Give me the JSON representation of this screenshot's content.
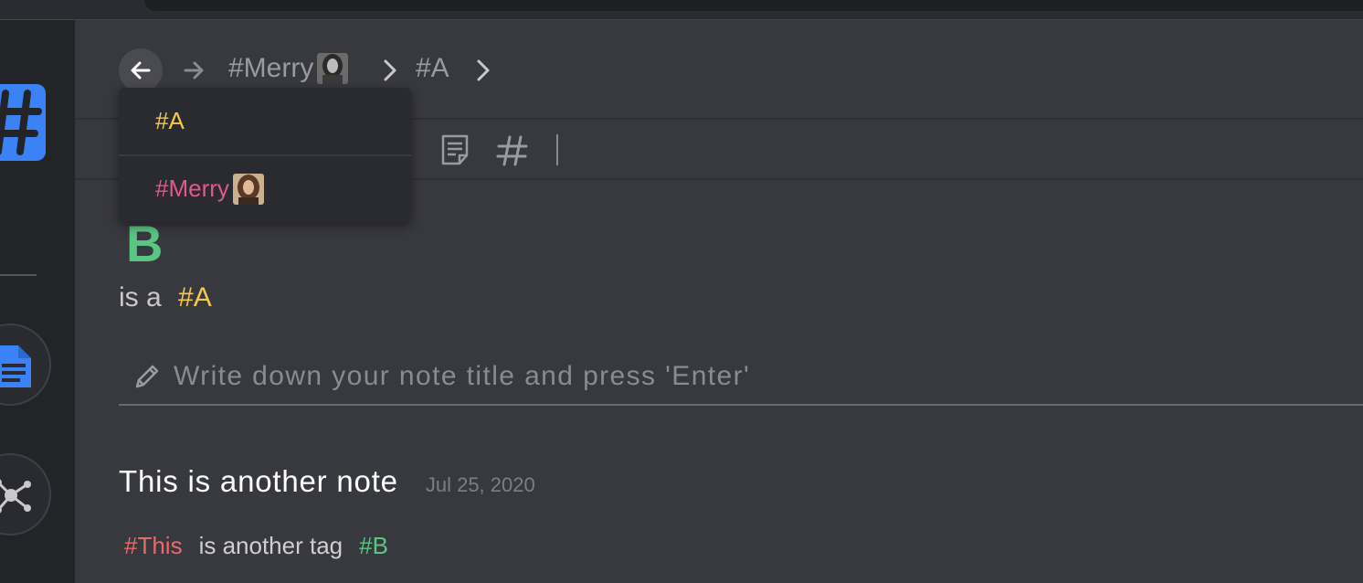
{
  "breadcrumb": {
    "items": [
      {
        "label": "#Merry"
      },
      {
        "label": "#A"
      }
    ]
  },
  "dropdown": {
    "items": [
      {
        "label": "#A",
        "color": "#f2c94c"
      },
      {
        "label": "#Merry",
        "color": "#e0588f"
      }
    ]
  },
  "note": {
    "title": "B",
    "description_prefix": "is a",
    "description_tag": "#A"
  },
  "composer": {
    "placeholder": "Write down your note title and press 'Enter'"
  },
  "list": {
    "items": [
      {
        "title": "This is another note",
        "date": "Jul 25, 2020",
        "tag_start": "#This",
        "text": "is another tag",
        "tag_end": "#B"
      }
    ]
  },
  "colors": {
    "accent_blue": "#3b82f6",
    "tag_yellow": "#f2c94c",
    "tag_pink": "#e0588f",
    "tag_green": "#5bc584",
    "tag_red": "#e86a6a"
  },
  "icons": [
    "hash-logo-icon",
    "notes-icon",
    "graph-icon",
    "arrow-left-icon",
    "arrow-right-icon",
    "chevron-right-icon",
    "document-icon",
    "hashtag-icon",
    "pencil-icon"
  ]
}
